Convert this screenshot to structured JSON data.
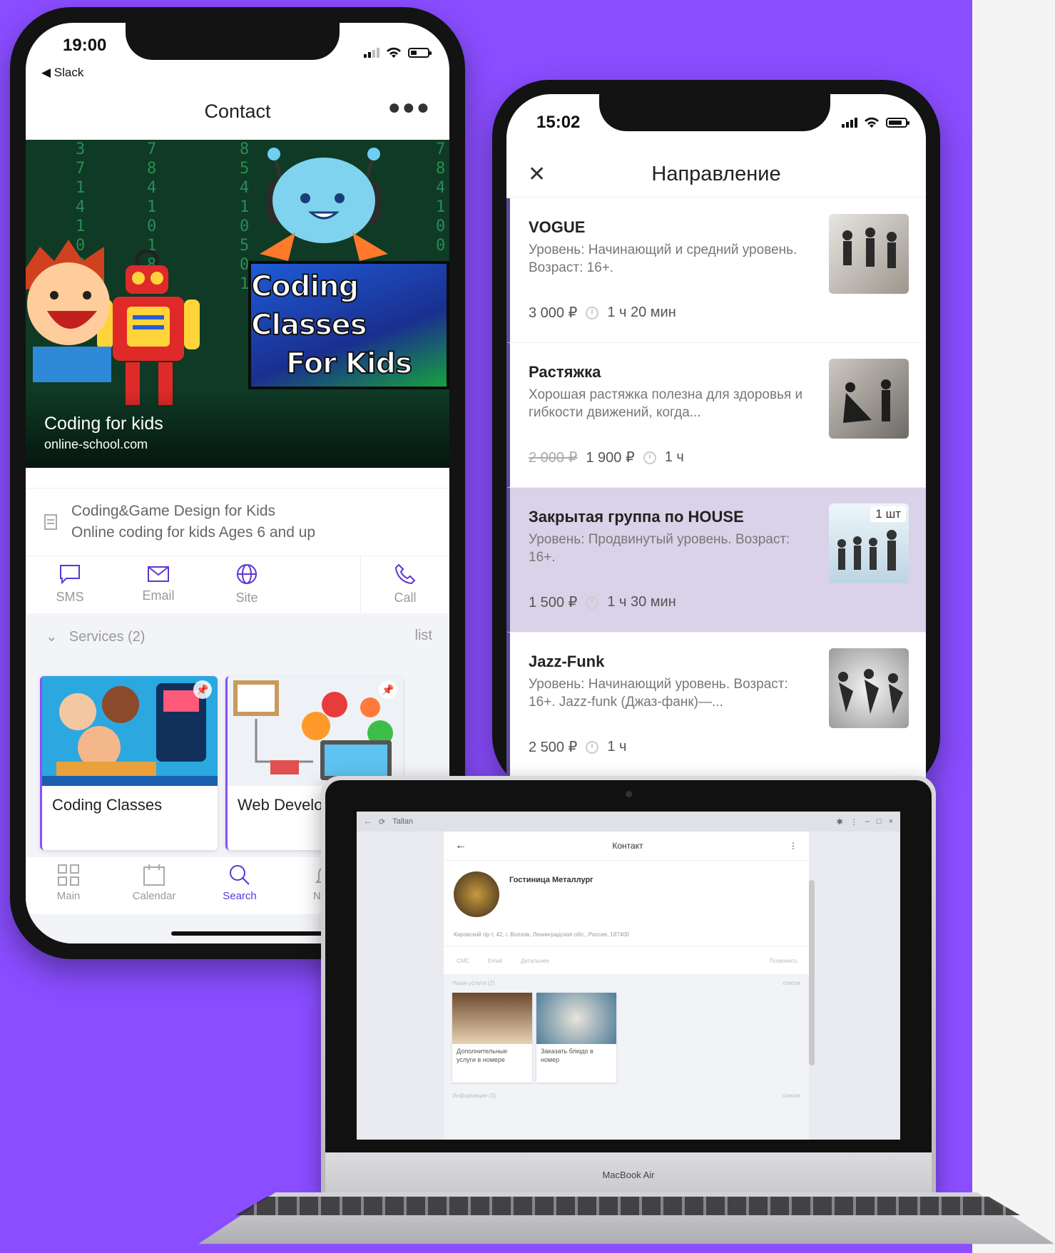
{
  "colors": {
    "accent": "#8a4dff",
    "brand_dark": "#5b35d6",
    "selected_row": "#d9d2e8"
  },
  "phone1": {
    "status": {
      "time": "19:00",
      "back_app": "◀ Slack"
    },
    "header": {
      "title": "Contact",
      "more_icon": "ellipsis-icon"
    },
    "hero": {
      "sign_line1": "Coding Classes",
      "sign_line2": "For Kids",
      "caption_title": "Coding for kids",
      "caption_sub": "online-school.com"
    },
    "info": {
      "line1": "Coding&Game Design for Kids",
      "line2": "Online coding for kids Ages 6 and up"
    },
    "actions": [
      {
        "label": "SMS",
        "icon": "chat-icon"
      },
      {
        "label": "Email",
        "icon": "mail-icon"
      },
      {
        "label": "Site",
        "icon": "globe-icon"
      },
      {
        "label": "Call",
        "icon": "phone-icon"
      }
    ],
    "services": {
      "title": "Services (2)",
      "list_link": "list",
      "cards": [
        {
          "label": "Coding Classes"
        },
        {
          "label": "Web Develo"
        }
      ]
    },
    "tabs": [
      {
        "label": "Main",
        "icon": "grid-icon"
      },
      {
        "label": "Calendar",
        "icon": "calendar-icon"
      },
      {
        "label": "Search",
        "icon": "search-icon",
        "active": true
      },
      {
        "label": "Notifi",
        "icon": "bell-icon"
      }
    ]
  },
  "phone2": {
    "status": {
      "time": "15:02"
    },
    "header": {
      "title": "Направление"
    },
    "items": [
      {
        "title": "VOGUE",
        "desc": "Уровень: Начинающий и средний уровень. Возраст: 16+.",
        "old_price": "",
        "price": "3 000 ₽",
        "duration": "1 ч 20 мин"
      },
      {
        "title": "Растяжка",
        "desc": "Хорошая растяжка полезна для здоровья и гибкости движений, когда...",
        "old_price": "2 000 ₽",
        "price": "1 900 ₽",
        "duration": "1 ч"
      },
      {
        "title": "Закрытая группа по HOUSE",
        "desc": "Уровень: Продвинутый уровень. Возраст: 16+.",
        "old_price": "",
        "price": "1 500 ₽",
        "duration": "1 ч 30 мин",
        "badge": "1 шт"
      },
      {
        "title": "Jazz-Funk",
        "desc": "Уровень: Начинающий уровень. Возраст: 16+. Jazz-funk (Джаз-фанк)—...",
        "old_price": "",
        "price": "2 500 ₽",
        "duration": "1 ч"
      }
    ]
  },
  "laptop": {
    "brand": "MacBook Air",
    "window_title": "Tallan",
    "app_title": "Контакт",
    "contact_name": "Гостиница Металлург",
    "address": "Кировский пр-т, 42, г. Волхов, Ленинградская обл., Россия, 187400",
    "actions": [
      "СМС",
      "Email",
      "Детальнее",
      "Позвонить"
    ],
    "services_title": "Наши услуги (2)",
    "services_link": "список",
    "cards": [
      "Дополнительные услуги в номере",
      "Заказать блюдо в номер"
    ],
    "info_title": "Информация (3)",
    "info_link": "список"
  }
}
